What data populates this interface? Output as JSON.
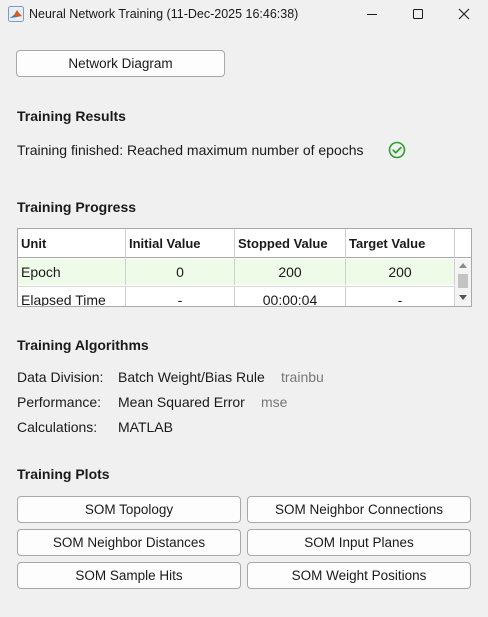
{
  "window": {
    "title": "Neural Network Training (11-Dec-2025 16:46:38)",
    "icon": "matlab-icon"
  },
  "network_diagram_button": "Network Diagram",
  "results": {
    "heading": "Training Results",
    "status": "Training finished: Reached maximum number of epochs",
    "status_icon": "check-circle-icon",
    "status_color": "#2e9e2e"
  },
  "progress": {
    "heading": "Training Progress",
    "columns": [
      "Unit",
      "Initial Value",
      "Stopped Value",
      "Target Value"
    ],
    "rows": [
      [
        "Epoch",
        "0",
        "200",
        "200"
      ],
      [
        "Elapsed Time",
        "-",
        "00:00:04",
        "-"
      ]
    ],
    "highlight_color": "#eefbe9"
  },
  "algorithms": {
    "heading": "Training Algorithms",
    "items": [
      {
        "label": "Data Division:",
        "value": "Batch Weight/Bias Rule",
        "code": "trainbu"
      },
      {
        "label": "Performance:",
        "value": "Mean Squared Error",
        "code": "mse"
      },
      {
        "label": "Calculations:",
        "value": "MATLAB",
        "code": ""
      }
    ]
  },
  "plots": {
    "heading": "Training Plots",
    "buttons": [
      "SOM Topology",
      "SOM Neighbor Connections",
      "SOM Neighbor Distances",
      "SOM Input Planes",
      "SOM Sample Hits",
      "SOM Weight Positions"
    ]
  }
}
